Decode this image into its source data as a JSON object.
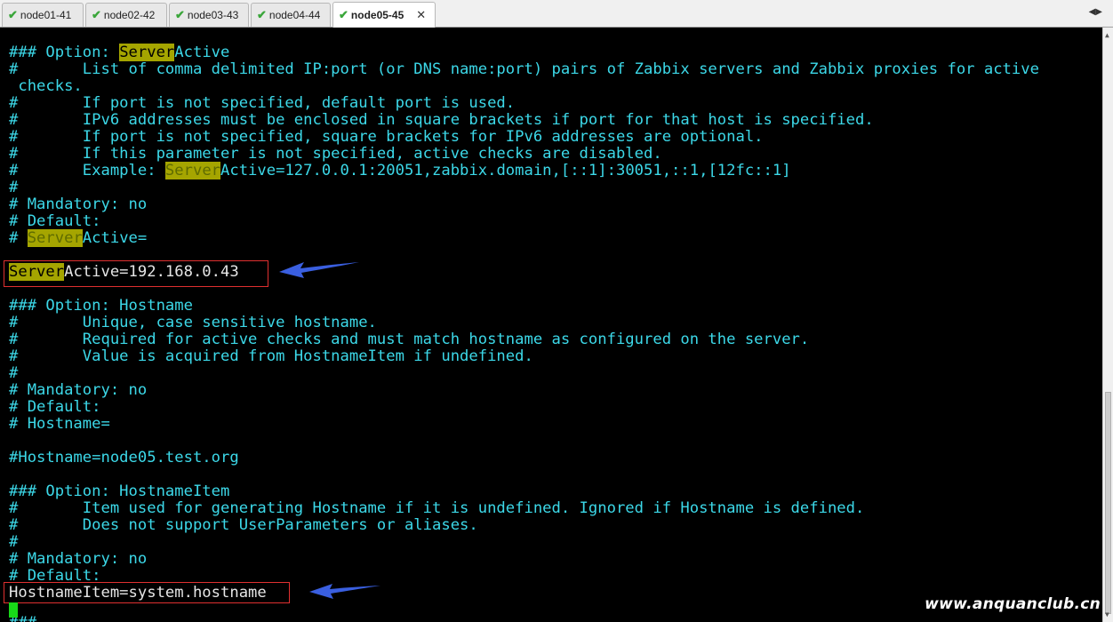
{
  "tabs": [
    {
      "label": "node01-41",
      "active": false
    },
    {
      "label": "node02-42",
      "active": false
    },
    {
      "label": "node03-43",
      "active": false
    },
    {
      "label": "node04-44",
      "active": false
    },
    {
      "label": "node05-45",
      "active": true
    }
  ],
  "tab_close_glyph": "✕",
  "tab_scroll_glyph": "◀▶",
  "terminal": {
    "lines": [
      "### Option: ",
      "#       List of comma delimited IP:port (or DNS name:port) pairs of Zabbix servers and Zabbix proxies for active",
      " checks.",
      "#       If port is not specified, default port is used.",
      "#       IPv6 addresses must be enclosed in square brackets if port for that host is specified.",
      "#       If port is not specified, square brackets for IPv6 addresses are optional.",
      "#       If this parameter is not specified, active checks are disabled.",
      "#       Example: ",
      "#",
      "# Mandatory: no",
      "# Default:",
      "# ",
      "",
      "",
      "",
      "### Option: Hostname",
      "#       Unique, case sensitive hostname.",
      "#       Required for active checks and must match hostname as configured on the server.",
      "#       Value is acquired from HostnameItem if undefined.",
      "#",
      "# Mandatory: no",
      "# Default:",
      "# Hostname=",
      "",
      "#Hostname=node05.test.org",
      "",
      "### Option: HostnameItem",
      "#       Item used for generating Hostname if it is undefined. Ignored if Hostname is defined.",
      "#       Does not support UserParameters or aliases.",
      "#",
      "# Mandatory: no",
      "# Default:",
      "HostnameItem=system.hostname",
      "### "
    ],
    "search_match": "Server",
    "line1_rest": "Active",
    "example_rest": "Active=127.0.0.1:20051,zabbix.domain,[::1]:30051,::1,[12fc::1]",
    "default_rest": "Active=",
    "config_rest": "Active=192.168.0.43"
  },
  "watermark": "www.anquanclub.cn",
  "colors": {
    "terminal_bg": "#000000",
    "terminal_text": "#3cd8e8",
    "search_highlight": "#a5a500",
    "annotation_box": "#e03030",
    "annotation_arrow": "#3a5fe0",
    "cursor": "#18d818"
  }
}
